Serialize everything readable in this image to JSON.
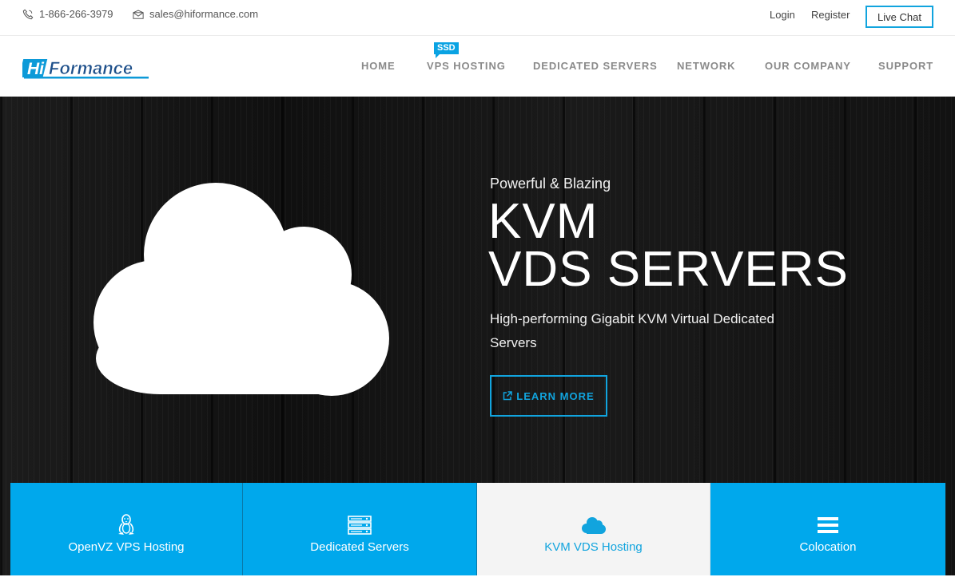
{
  "topbar": {
    "phone": "1-866-266-3979",
    "email": "sales@hiformance.com",
    "login_label": "Login",
    "register_label": "Register",
    "livechat_label": "Live Chat",
    "phone_icon": "phone-icon",
    "email_icon": "envelope-icon"
  },
  "logo": {
    "text_hi": "Hi",
    "text_rest": "Formance"
  },
  "nav": {
    "home": "HOME",
    "vps": "VPS HOSTING",
    "vps_badge": "SSD",
    "dedicated": "DEDICATED SERVERS",
    "network": "NETWORK",
    "company": "OUR COMPANY",
    "support": "SUPPORT"
  },
  "hero": {
    "kicker": "Powerful & Blazing",
    "title_line1": "KVM",
    "title_line2": "VDS SERVERS",
    "description": "High-performing Gigabit KVM Virtual Dedicated Servers",
    "cta_label": "LEARN MORE",
    "cta_icon": "external-link-icon",
    "art_icon": "cloud-icon"
  },
  "tiles": [
    {
      "label": "OpenVZ VPS Hosting",
      "icon": "linux-tux-icon"
    },
    {
      "label": "Dedicated Servers",
      "icon": "server-rack-icon"
    },
    {
      "label": "KVM VDS Hosting",
      "icon": "cloud-icon"
    },
    {
      "label": "Colocation",
      "icon": "bars-icon"
    }
  ],
  "colors": {
    "accent": "#00a8ec",
    "hero_background": "#151515",
    "active_tile_background": "#f4f4f4",
    "nav_text": "#8a8a8a"
  }
}
